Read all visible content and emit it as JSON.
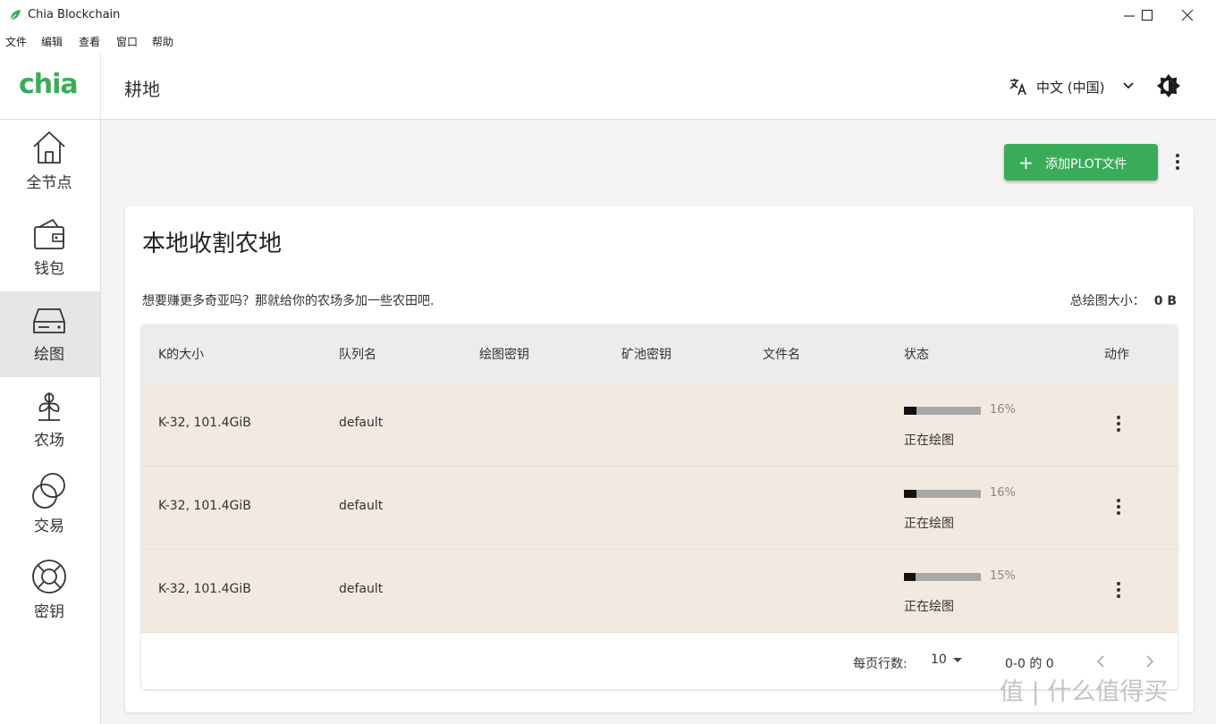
{
  "window": {
    "title": "Chia Blockchain"
  },
  "menu": [
    "文件",
    "编辑",
    "查看",
    "窗口",
    "帮助"
  ],
  "header": {
    "logo": "chia",
    "title": "耕地",
    "language": "中文 (中国)"
  },
  "sidebar": {
    "items": [
      {
        "label": "全节点",
        "icon": "home-icon"
      },
      {
        "label": "钱包",
        "icon": "wallet-icon"
      },
      {
        "label": "绘图",
        "icon": "plot-drive-icon",
        "active": true
      },
      {
        "label": "农场",
        "icon": "plant-icon"
      },
      {
        "label": "交易",
        "icon": "trade-circles-icon"
      },
      {
        "label": "密钥",
        "icon": "keys-lifebuoy-icon"
      }
    ]
  },
  "toolbar": {
    "add_plot_label": "添加PLOT文件"
  },
  "card": {
    "title": "本地收割农地",
    "description": "想要赚更多奇亚吗？那就给你的农场多加一些农田吧.",
    "total_label": "总绘图大小：",
    "total_value": "0 B"
  },
  "table": {
    "headers": [
      "K的大小",
      "队列名",
      "绘图密钥",
      "矿池密钥",
      "文件名",
      "状态",
      "动作"
    ],
    "rows": [
      {
        "k_size": "K-32, 101.4GiB",
        "queue": "default",
        "plot_key": "",
        "pool_key": "",
        "filename": "",
        "progress": 0.16,
        "progress_label": "16%",
        "status": "正在绘图"
      },
      {
        "k_size": "K-32, 101.4GiB",
        "queue": "default",
        "plot_key": "",
        "pool_key": "",
        "filename": "",
        "progress": 0.16,
        "progress_label": "16%",
        "status": "正在绘图"
      },
      {
        "k_size": "K-32, 101.4GiB",
        "queue": "default",
        "plot_key": "",
        "pool_key": "",
        "filename": "",
        "progress": 0.15,
        "progress_label": "15%",
        "status": "正在绘图"
      }
    ]
  },
  "pagination": {
    "rows_per_page_label": "每页行数:",
    "rows_per_page": "10",
    "range": "0-0 的 0"
  },
  "watermark": "值 | 什么值得买",
  "colors": {
    "accent": "#3aac59",
    "row_bg": "#f2eae0",
    "header_bg": "#ececec",
    "active_nav": "#e6e6e6"
  }
}
